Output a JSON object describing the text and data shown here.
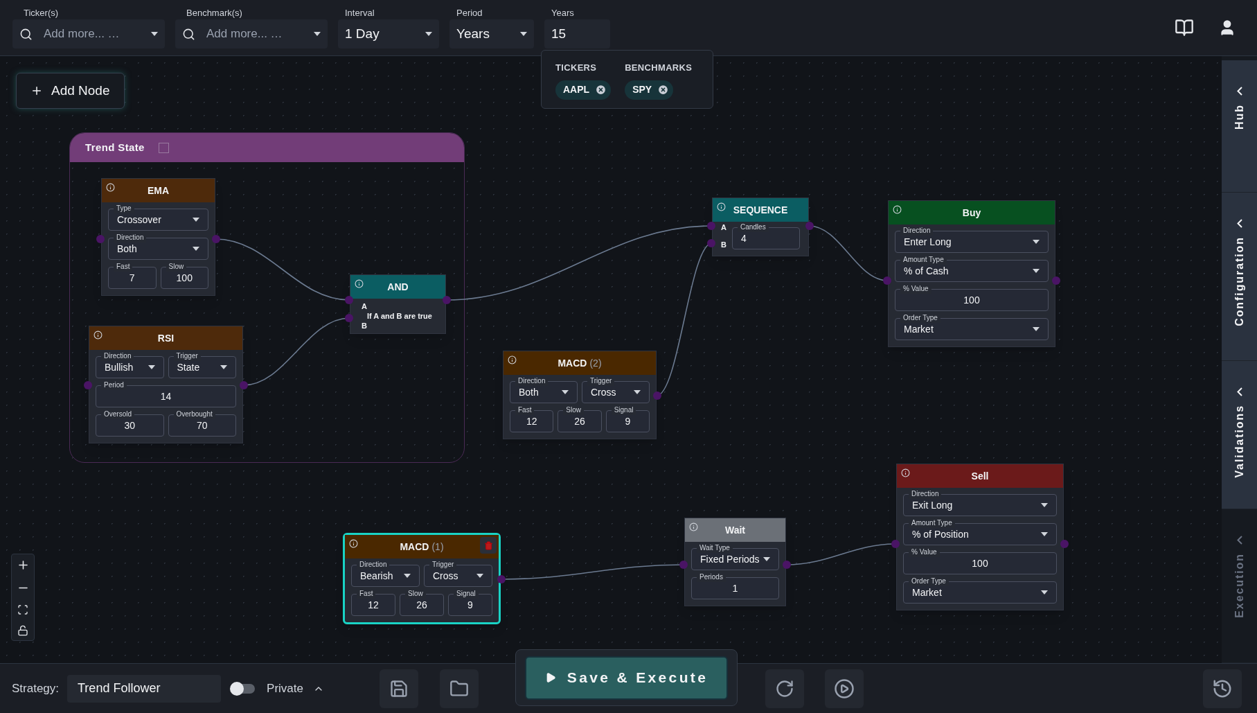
{
  "toolbar": {
    "fields": [
      {
        "kind": "search",
        "label": "Ticker(s)",
        "placeholder": "Add more... …"
      },
      {
        "kind": "search",
        "label": "Benchmark(s)",
        "placeholder": "Add more... …"
      },
      {
        "kind": "select",
        "label": "Interval",
        "value": "1 Day"
      },
      {
        "kind": "select",
        "label": "Period",
        "value": "Years"
      },
      {
        "kind": "text",
        "label": "Years",
        "value": "15"
      }
    ]
  },
  "selection_popup": {
    "groups": [
      {
        "heading": "TICKERS",
        "chips": [
          "AAPL"
        ]
      },
      {
        "heading": "BENCHMARKS",
        "chips": [
          "SPY"
        ]
      }
    ]
  },
  "add_node_button": "Add Node",
  "group": {
    "title": "Trend State",
    "checked": false
  },
  "nodes": [
    {
      "title": "EMA",
      "color": "#4e2a0b",
      "selected": false,
      "rows": [
        [
          {
            "kind": "select",
            "label": "Type",
            "value": "Crossover"
          }
        ],
        [
          {
            "kind": "select",
            "label": "Direction",
            "value": "Both"
          }
        ],
        [
          {
            "kind": "number",
            "label": "Fast",
            "value": "7"
          },
          {
            "kind": "number",
            "label": "Slow",
            "value": "100"
          }
        ]
      ]
    },
    {
      "title": "RSI",
      "color": "#4e2a0b",
      "selected": false,
      "rows": [
        [
          {
            "kind": "select",
            "label": "Direction",
            "value": "Bullish"
          },
          {
            "kind": "select",
            "label": "Trigger",
            "value": "State"
          }
        ],
        [
          {
            "kind": "number",
            "label": "Period",
            "value": "14"
          }
        ],
        [
          {
            "kind": "number",
            "label": "Oversold",
            "value": "30"
          },
          {
            "kind": "number",
            "label": "Overbought",
            "value": "70"
          }
        ]
      ]
    },
    {
      "title": "AND",
      "color": "#0b5d62",
      "selected": false,
      "ports": [
        "A",
        "B"
      ],
      "description": "If A and B are true"
    },
    {
      "title": "SEQUENCE",
      "color": "#0b5d62",
      "selected": false,
      "ports": [
        "A",
        "B"
      ],
      "rows": [
        [
          {
            "kind": "text",
            "label": "Candles",
            "value": "4"
          }
        ]
      ]
    },
    {
      "title": "Buy",
      "color": "#075020",
      "selected": false,
      "rows": [
        [
          {
            "kind": "select",
            "label": "Direction",
            "value": "Enter Long"
          }
        ],
        [
          {
            "kind": "select",
            "label": "Amount Type",
            "value": "% of Cash"
          }
        ],
        [
          {
            "kind": "number",
            "label": "% Value",
            "value": "100"
          }
        ],
        [
          {
            "kind": "select",
            "label": "Order Type",
            "value": "Market"
          }
        ]
      ]
    },
    {
      "title": "MACD",
      "counter": "(2)",
      "color": "#4a2800",
      "selected": false,
      "rows": [
        [
          {
            "kind": "select",
            "label": "Direction",
            "value": "Both"
          },
          {
            "kind": "select",
            "label": "Trigger",
            "value": "Cross"
          }
        ],
        [
          {
            "kind": "number",
            "label": "Fast",
            "value": "12"
          },
          {
            "kind": "number",
            "label": "Slow",
            "value": "26"
          },
          {
            "kind": "number",
            "label": "Signal",
            "value": "9"
          }
        ]
      ]
    },
    {
      "title": "MACD",
      "counter": "(1)",
      "color": "#4a2800",
      "selected": true,
      "rows": [
        [
          {
            "kind": "select",
            "label": "Direction",
            "value": "Bearish"
          },
          {
            "kind": "select",
            "label": "Trigger",
            "value": "Cross"
          }
        ],
        [
          {
            "kind": "number",
            "label": "Fast",
            "value": "12"
          },
          {
            "kind": "number",
            "label": "Slow",
            "value": "26"
          },
          {
            "kind": "number",
            "label": "Signal",
            "value": "9"
          }
        ]
      ]
    },
    {
      "title": "Wait",
      "color": "#6b7077",
      "selected": false,
      "rows": [
        [
          {
            "kind": "select",
            "label": "Wait Type",
            "value": "Fixed Periods"
          }
        ],
        [
          {
            "kind": "number",
            "label": "Periods",
            "value": "1"
          }
        ]
      ]
    },
    {
      "title": "Sell",
      "color": "#6b1a1a",
      "selected": false,
      "rows": [
        [
          {
            "kind": "select",
            "label": "Direction",
            "value": "Exit Long"
          }
        ],
        [
          {
            "kind": "select",
            "label": "Amount Type",
            "value": "% of Position"
          }
        ],
        [
          {
            "kind": "number",
            "label": "% Value",
            "value": "100"
          }
        ],
        [
          {
            "kind": "select",
            "label": "Order Type",
            "value": "Market"
          }
        ]
      ]
    }
  ],
  "sidebar_tabs": [
    {
      "label": "Hub",
      "active": true
    },
    {
      "label": "Configuration",
      "active": true
    },
    {
      "label": "Validations",
      "active": true
    },
    {
      "label": "Execution",
      "active": false
    }
  ],
  "bottom_bar": {
    "strategy_label": "Strategy:",
    "strategy_name": "Trend Follower",
    "visibility": {
      "label": "Private",
      "on": false
    },
    "execute_button": "Save & Execute"
  }
}
